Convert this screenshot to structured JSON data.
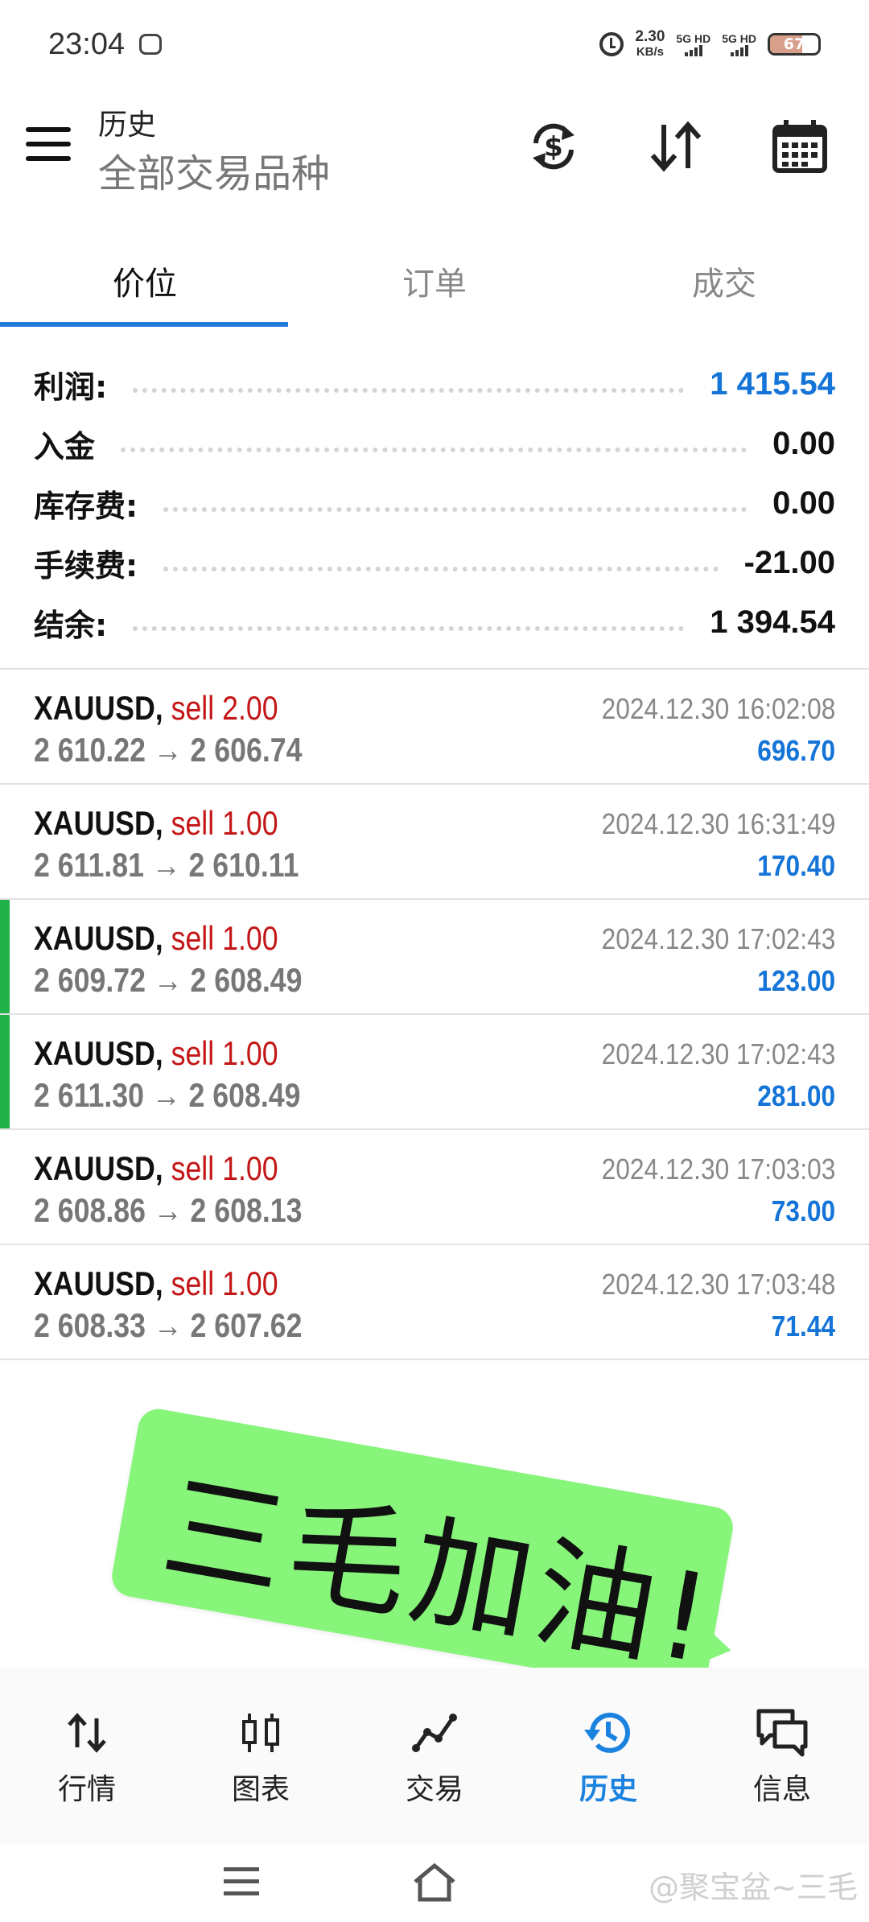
{
  "status_bar": {
    "time": "23:04",
    "net_speed_value": "2.30",
    "net_speed_unit": "KB/s",
    "sim1_label": "5G HD",
    "sim2_label": "5G HD",
    "battery_percent": "67",
    "battery_level": 0.67
  },
  "header": {
    "title": "历史",
    "subtitle": "全部交易品种",
    "icons": [
      "menu-icon",
      "currency-exchange-icon",
      "sort-icon",
      "calendar-icon"
    ]
  },
  "tabs": [
    {
      "label": "价位",
      "active": true
    },
    {
      "label": "订单",
      "active": false
    },
    {
      "label": "成交",
      "active": false
    }
  ],
  "summary": [
    {
      "label": "利润:",
      "value": "1 415.54",
      "highlight": true
    },
    {
      "label": "入金",
      "value": "0.00",
      "highlight": false
    },
    {
      "label": "库存费:",
      "value": "0.00",
      "highlight": false
    },
    {
      "label": "手续费:",
      "value": "-21.00",
      "highlight": false
    },
    {
      "label": "结余:",
      "value": "1 394.54",
      "highlight": false
    }
  ],
  "trades": [
    {
      "symbol": "XAUUSD,",
      "side": "sell 2.00",
      "prices": "2 610.22 → 2 606.74",
      "time": "2024.12.30 16:02:08",
      "profit": "696.70",
      "marked": false
    },
    {
      "symbol": "XAUUSD,",
      "side": "sell 1.00",
      "prices": "2 611.81 → 2 610.11",
      "time": "2024.12.30 16:31:49",
      "profit": "170.40",
      "marked": false
    },
    {
      "symbol": "XAUUSD,",
      "side": "sell 1.00",
      "prices": "2 609.72 → 2 608.49",
      "time": "2024.12.30 17:02:43",
      "profit": "123.00",
      "marked": true
    },
    {
      "symbol": "XAUUSD,",
      "side": "sell 1.00",
      "prices": "2 611.30 → 2 608.49",
      "time": "2024.12.30 17:02:43",
      "profit": "281.00",
      "marked": true
    },
    {
      "symbol": "XAUUSD,",
      "side": "sell 1.00",
      "prices": "2 608.86 → 2 608.13",
      "time": "2024.12.30 17:03:03",
      "profit": "73.00",
      "marked": false
    },
    {
      "symbol": "XAUUSD,",
      "side": "sell 1.00",
      "prices": "2 608.33 → 2 607.62",
      "time": "2024.12.30 17:03:48",
      "profit": "71.44",
      "marked": false
    }
  ],
  "sticker": {
    "text": "三毛加油!"
  },
  "bottom_nav": [
    {
      "label": "行情",
      "icon": "quotes-icon",
      "active": false
    },
    {
      "label": "图表",
      "icon": "chart-icon",
      "active": false
    },
    {
      "label": "交易",
      "icon": "trade-icon",
      "active": false
    },
    {
      "label": "历史",
      "icon": "history-icon",
      "active": true
    },
    {
      "label": "信息",
      "icon": "messages-icon",
      "active": false
    }
  ],
  "watermark": "@聚宝盆~三毛",
  "colors": {
    "accent": "#1e7bd6",
    "profit_blue": "#1474d8",
    "sell_red": "#c41616",
    "marker_green": "#22b24c",
    "sticker_green": "#86f57a"
  }
}
